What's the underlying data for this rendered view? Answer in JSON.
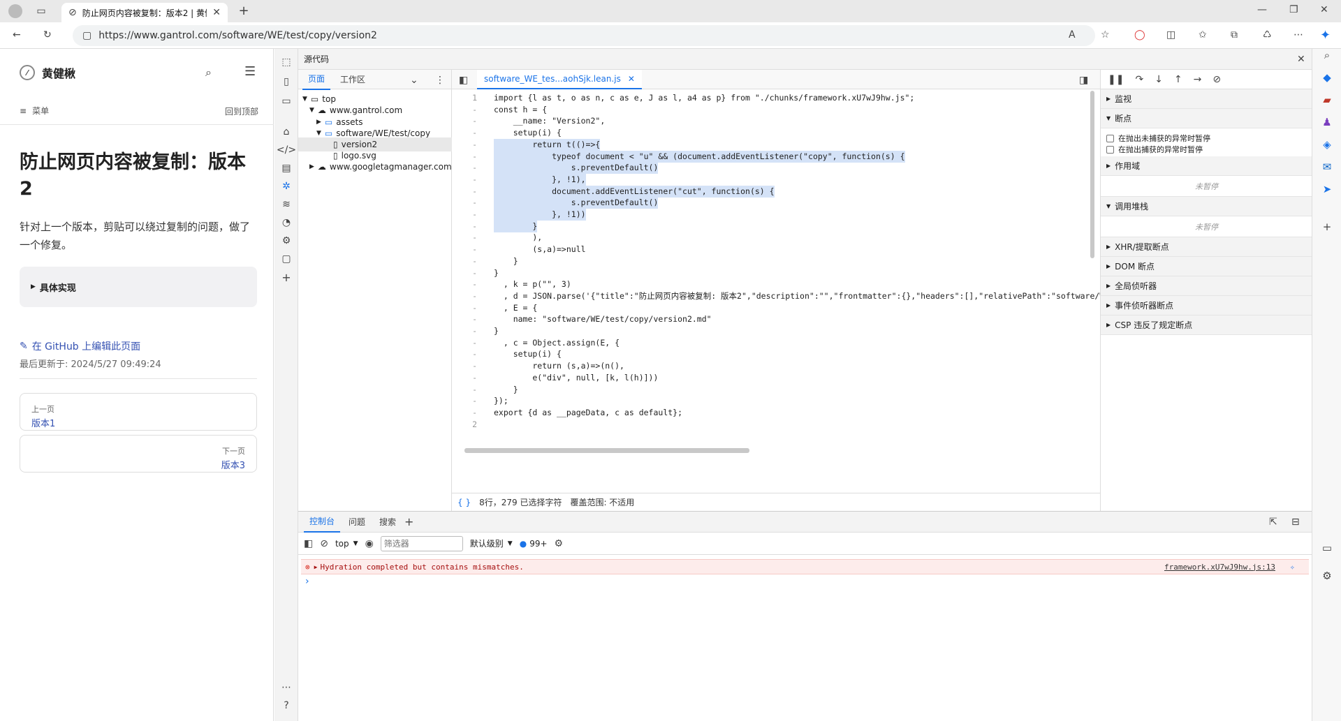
{
  "browser": {
    "tab_title": "防止网页内容被复制：版本2 | 黄健",
    "url": "https://www.gantrol.com/software/WE/test/copy/version2"
  },
  "page": {
    "brand": "黄健楸",
    "menu_label": "菜单",
    "back_to_top": "回到顶部",
    "title": "防止网页内容被复制：版本2",
    "description": "针对上一个版本，剪贴可以绕过复制的问题，做了一个修复。",
    "details_summary": "具体实现",
    "edit_link": "在 GitHub 上编辑此页面",
    "last_updated": "最后更新于: 2024/5/27 09:49:24",
    "prev_label": "上一页",
    "prev_title": "版本1",
    "next_label": "下一页",
    "next_title": "版本3"
  },
  "devtools": {
    "panel_title": "源代码",
    "nav_tabs": [
      "页面",
      "工作区"
    ],
    "tree": [
      {
        "label": "top",
        "indent": 0,
        "type": "frame"
      },
      {
        "label": "www.gantrol.com",
        "indent": 1,
        "type": "cloud"
      },
      {
        "label": "assets",
        "indent": 2,
        "type": "folder"
      },
      {
        "label": "software/WE/test/copy",
        "indent": 2,
        "type": "folder"
      },
      {
        "label": "version2",
        "indent": 3,
        "type": "file"
      },
      {
        "label": "logo.svg",
        "indent": 2,
        "type": "file"
      },
      {
        "label": "www.googletagmanager.com",
        "indent": 1,
        "type": "cloud"
      }
    ],
    "editor_tab": "software_WE_tes...aohSjk.lean.js",
    "code_lines": [
      {
        "n": "1",
        "t": "import {l as t, o as n, c as e, J as l, a4 as p} from \"./chunks/framework.xU7wJ9hw.js\";",
        "hl": false
      },
      {
        "n": "-",
        "t": "const h = {",
        "hl": false
      },
      {
        "n": "-",
        "t": "    __name: \"Version2\",",
        "hl": false
      },
      {
        "n": "-",
        "t": "    setup(i) {",
        "hl": false
      },
      {
        "n": "-",
        "t": "        return t(()=>{",
        "hl": true
      },
      {
        "n": "-",
        "t": "            typeof document < \"u\" && (document.addEventListener(\"copy\", function(s) {",
        "hl": true
      },
      {
        "n": "-",
        "t": "                s.preventDefault()",
        "hl": true
      },
      {
        "n": "-",
        "t": "            }, !1),",
        "hl": true
      },
      {
        "n": "-",
        "t": "            document.addEventListener(\"cut\", function(s) {",
        "hl": true
      },
      {
        "n": "-",
        "t": "                s.preventDefault()",
        "hl": true
      },
      {
        "n": "-",
        "t": "            }, !1))",
        "hl": true
      },
      {
        "n": "-",
        "t": "        }",
        "hl": true
      },
      {
        "n": "-",
        "t": "        ),",
        "hl": false
      },
      {
        "n": "-",
        "t": "        (s,a)=>null",
        "hl": false
      },
      {
        "n": "-",
        "t": "    }",
        "hl": false
      },
      {
        "n": "-",
        "t": "}",
        "hl": false
      },
      {
        "n": "-",
        "t": "  , k = p(\"\", 3)",
        "hl": false
      },
      {
        "n": "-",
        "t": "  , d = JSON.parse('{\"title\":\"防止网页内容被复制: 版本2\",\"description\":\"\",\"frontmatter\":{},\"headers\":[],\"relativePath\":\"software/WE",
        "hl": false
      },
      {
        "n": "-",
        "t": "  , E = {",
        "hl": false
      },
      {
        "n": "-",
        "t": "    name: \"software/WE/test/copy/version2.md\"",
        "hl": false
      },
      {
        "n": "-",
        "t": "}",
        "hl": false
      },
      {
        "n": "-",
        "t": "  , c = Object.assign(E, {",
        "hl": false
      },
      {
        "n": "-",
        "t": "    setup(i) {",
        "hl": false
      },
      {
        "n": "-",
        "t": "        return (s,a)=>(n(),",
        "hl": false
      },
      {
        "n": "-",
        "t": "        e(\"div\", null, [k, l(h)]))",
        "hl": false
      },
      {
        "n": "-",
        "t": "    }",
        "hl": false
      },
      {
        "n": "-",
        "t": "});",
        "hl": false
      },
      {
        "n": "-",
        "t": "export {d as __pageData, c as default};",
        "hl": false
      },
      {
        "n": "2",
        "t": "",
        "hl": false
      }
    ],
    "status_braces": "{ }",
    "status_selection": "8行，279 已选择字符",
    "status_coverage": "覆盖范围: 不适用",
    "debugger": {
      "watch": "监视",
      "breakpoints": "断点",
      "pause_uncaught": "在抛出未捕获的异常时暂停",
      "pause_caught": "在抛出捕获的异常时暂停",
      "scope": "作用域",
      "scope_empty": "未暂停",
      "callstack": "调用堆栈",
      "callstack_empty": "未暂停",
      "xhr": "XHR/提取断点",
      "dom": "DOM 断点",
      "global_listeners": "全局侦听器",
      "event_listener_bp": "事件侦听器断点",
      "csp": "CSP 违反了规定断点"
    },
    "console": {
      "tabs": [
        "控制台",
        "问题",
        "搜索"
      ],
      "context": "top",
      "filter_placeholder": "筛选器",
      "level": "默认级别",
      "issue_count": "99+",
      "error_text": "Hydration completed but contains mismatches.",
      "error_source": "framework.xU7wJ9hw.js:13",
      "prompt": "›"
    }
  }
}
